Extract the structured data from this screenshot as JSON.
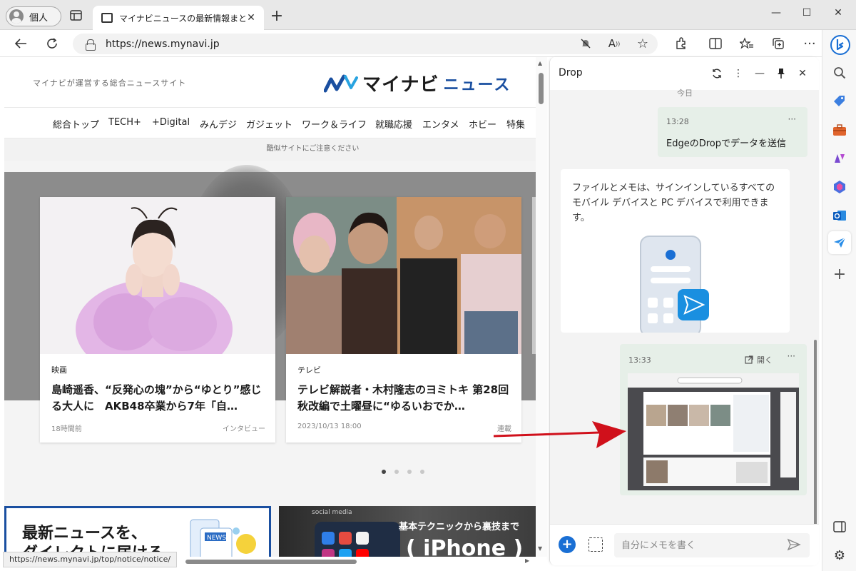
{
  "browser": {
    "profile_label": "個人",
    "tab_title": "マイナビニュースの最新情報まとめ - エ",
    "url": "https://news.mynavi.jp",
    "status_url": "https://news.mynavi.jp/top/notice/notice/"
  },
  "site": {
    "tagline": "マイナビが運営する総合ニュースサイト",
    "logo_main": "マイナビ",
    "logo_sub": "ニュース",
    "nav": [
      "総合トップ",
      "TECH+",
      "+Digital",
      "みんデジ",
      "ガジェット",
      "ワーク＆ライフ",
      "就職応援",
      "エンタメ",
      "ホビー",
      "特集"
    ],
    "notice": "酷似サイトにご注意ください",
    "cards": [
      {
        "category": "映画",
        "title": "島崎遥香、“反発心の塊”から“ゆとり”感じる大人に　AKB48卒業から7年「自…",
        "time": "18時間前",
        "tag": "インタビュー"
      },
      {
        "category": "テレビ",
        "title": "テレビ解説者・木村隆志のヨミトキ 第28回 秋改編で土曜昼に“ゆるいおでか…",
        "time": "2023/10/13 18:00",
        "tag": "連載"
      }
    ],
    "banner_left_line1": "最新ニュースを、",
    "banner_left_line2": "ダイレクトに届ける",
    "banner_left_badge": "NEWS",
    "banner_right_social": "social media",
    "banner_right_top": "基本テクニックから裏技まで",
    "banner_right_main": "( iPhone )"
  },
  "drop": {
    "title": "Drop",
    "today": "今日",
    "messages": [
      {
        "time": "13:28",
        "text": "EdgeのDropでデータを送信"
      },
      {
        "time": "13:33",
        "open_label": "開く"
      }
    ],
    "info_text": "ファイルとメモは、サインインしているすべてのモバイル デバイスと PC デバイスで利用できます。",
    "input_placeholder": "自分にメモを書く"
  },
  "colors": {
    "accent_blue": "#1a4fa0",
    "edge_blue": "#1a6fd4",
    "drop_bubble": "#e6efe8",
    "arrow_red": "#d0101b"
  }
}
